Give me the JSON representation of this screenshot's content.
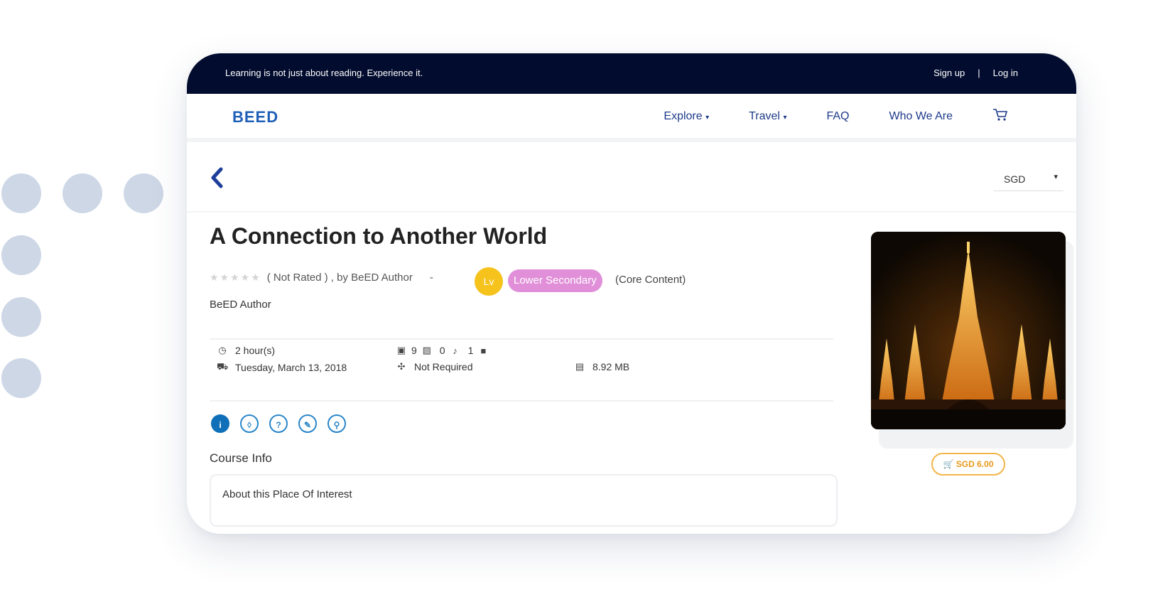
{
  "topbar": {
    "tagline": "Learning is not just about reading. Experience it.",
    "signup_label": "Sign up",
    "separator": "|",
    "login_label": "Log in"
  },
  "nav": {
    "logo": "BEED",
    "items": [
      {
        "label": "Explore",
        "caret": "▾"
      },
      {
        "label": "Travel",
        "caret": "▾"
      },
      {
        "label": "FAQ"
      },
      {
        "label": "Who We Are"
      }
    ],
    "cart_icon": "cart-icon"
  },
  "toolbar": {
    "currency": "SGD",
    "currency_caret": "▾"
  },
  "course": {
    "title": "A Connection to Another World",
    "stars": "★★★★★",
    "rating_text": "( Not Rated ) , by BeED Author",
    "dash": "-",
    "level_icon": "Lv",
    "level_label": "Lower Secondary",
    "content_type": "(Core Content)",
    "author": "BeED Author"
  },
  "meta": {
    "duration": "2 hour(s)",
    "date": "Tuesday, March 13, 2018",
    "counts_images": "9",
    "counts_audio": "0",
    "counts_video": "1",
    "requirement": "Not Required",
    "size": "8.92 MB"
  },
  "tabs": {
    "icons": [
      "info-icon",
      "lightbulb-icon",
      "question-icon",
      "edit-icon",
      "location-icon"
    ],
    "glyphs": [
      "i",
      "◊",
      "?",
      "✎",
      "⚲"
    ],
    "section_title": "Course Info",
    "box_text": "About this Place Of Interest"
  },
  "price": {
    "label": "SGD 6.00"
  },
  "colors": {
    "topbar_bg": "#020c2e",
    "nav_link": "#1e3a8a",
    "level_badge": "#e08fd8",
    "level_icon": "#f6c21c",
    "price_border": "#f3b54a",
    "tab_active": "#0f6fb8"
  }
}
